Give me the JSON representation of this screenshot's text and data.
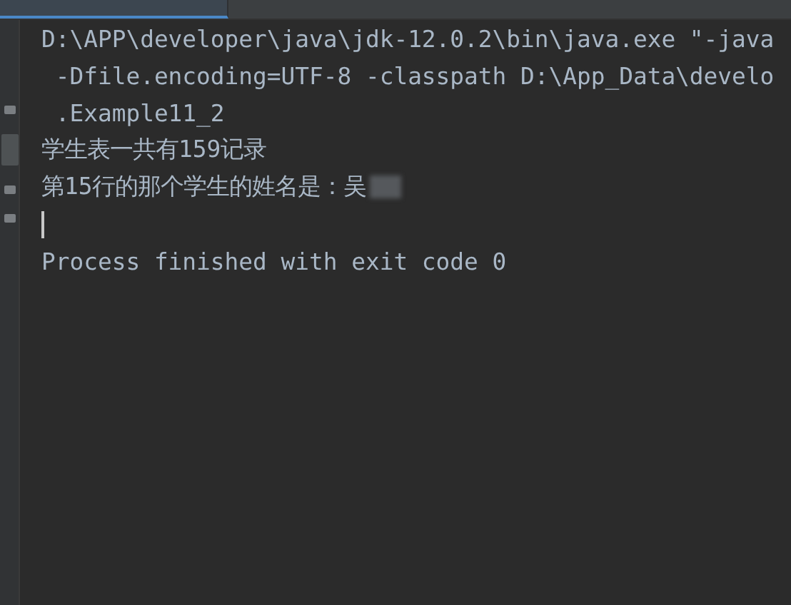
{
  "tabs": [
    {
      "selected": true
    }
  ],
  "console": {
    "lines": [
      {
        "kind": "text",
        "text": "D:\\APP\\developer\\java\\jdk-12.0.2\\bin\\java.exe \"-java"
      },
      {
        "kind": "text",
        "text": " -Dfile.encoding=UTF-8 -classpath D:\\App_Data\\develo"
      },
      {
        "kind": "text",
        "text": " .Example11_2"
      },
      {
        "kind": "text",
        "text": "学生表一共有159记录"
      },
      {
        "kind": "masked",
        "text": "第15行的那个学生的姓名是：吴"
      },
      {
        "kind": "cursor"
      },
      {
        "kind": "text",
        "text": "Process finished with exit code 0"
      }
    ]
  }
}
